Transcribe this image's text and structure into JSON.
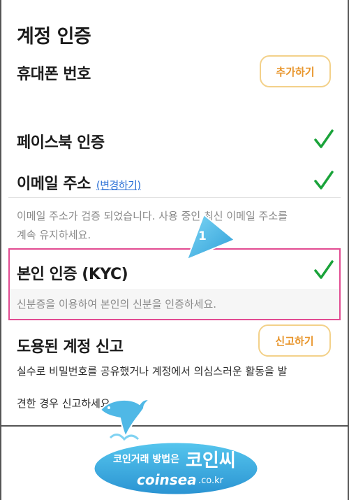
{
  "page_title": "계정 인증",
  "phone": {
    "label": "휴대폰 번호",
    "button_label": "추가하기"
  },
  "facebook": {
    "label": "페이스북 인증"
  },
  "email": {
    "label": "이메일 주소",
    "change_link": "(변경하기)",
    "desc_line1": "이메일 주소가 검증 되었습니다. 사용 중인 최신 이메일 주소를",
    "desc_line2": "계속 유지하세요."
  },
  "kyc": {
    "label": "본인 인증 (KYC)",
    "desc": "신분증을 이용하여 본인의 신분을 인증하세요."
  },
  "report": {
    "label": "도용된 계정 신고",
    "button_label": "신고하기",
    "desc_line1": "실수로 비밀번호를 공유했거나 계정에서 의심스러운 활동을 발",
    "desc_line2": "견한 경우 신고하세요."
  },
  "annotation": {
    "step_number": "1"
  },
  "watermark": {
    "text1": "코인거래 방법은",
    "text2": "코인씨",
    "text3": "coinsea",
    "text4": ".co.kr"
  },
  "colors": {
    "accent": "#e8952b",
    "check": "#1aa33a",
    "highlight": "#e24c92",
    "link": "#2a6fd6"
  },
  "icons": {
    "check": "check-icon",
    "pointer": "pointer-arrow-icon",
    "mascot": "dolphin-icon"
  }
}
